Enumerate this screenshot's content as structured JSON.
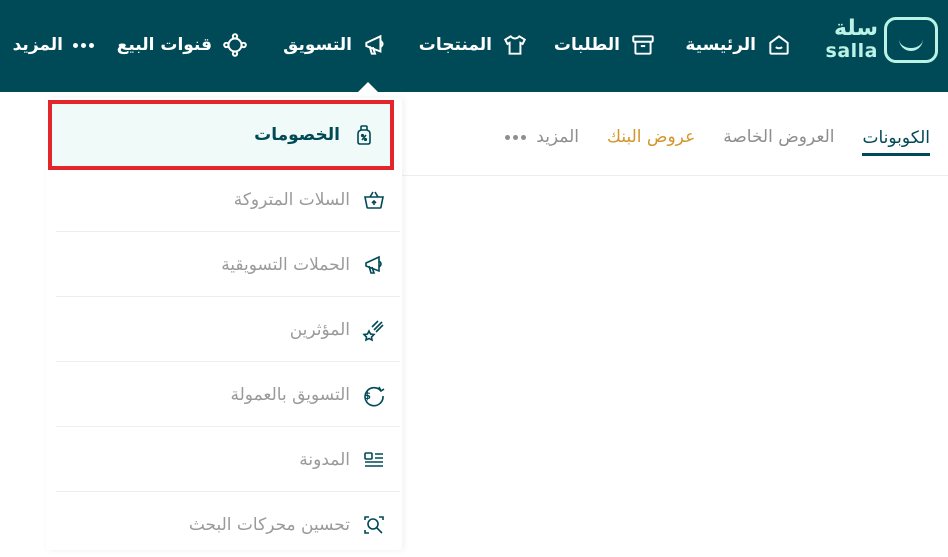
{
  "brand": {
    "name_ar": "سلة",
    "name_en": "salla",
    "color": "#004956",
    "accent": "#baf3e6"
  },
  "nav": {
    "items": [
      {
        "label": "الرئيسية",
        "icon": "home-icon"
      },
      {
        "label": "الطلبات",
        "icon": "orders-box-icon"
      },
      {
        "label": "المنتجات",
        "icon": "shirt-icon"
      },
      {
        "label": "التسويق",
        "icon": "megaphone-icon",
        "active": true
      },
      {
        "label": "قنوات البيع",
        "icon": "channels-icon"
      },
      {
        "label": "المزيد",
        "icon": "more-dots-icon"
      }
    ]
  },
  "tabs": [
    {
      "label": "الكوبونات",
      "active": true
    },
    {
      "label": "العروض الخاصة"
    },
    {
      "label": "عروض البنك",
      "color": "#d4962c"
    },
    {
      "label": "المزيد",
      "icon": "more-dots-icon"
    }
  ],
  "dropdown": {
    "items": [
      {
        "label": "الخصومات",
        "icon": "discount-tag-icon",
        "highlighted": true
      },
      {
        "label": "السلات المتروكة",
        "icon": "abandoned-basket-icon"
      },
      {
        "label": "الحملات التسويقية",
        "icon": "campaign-megaphone-icon"
      },
      {
        "label": "المؤثرين",
        "icon": "influencer-star-icon"
      },
      {
        "label": "التسويق بالعمولة",
        "icon": "affiliate-coin-icon"
      },
      {
        "label": "المدونة",
        "icon": "blog-icon"
      },
      {
        "label": "تحسين محركات البحث",
        "icon": "seo-search-icon"
      }
    ]
  }
}
